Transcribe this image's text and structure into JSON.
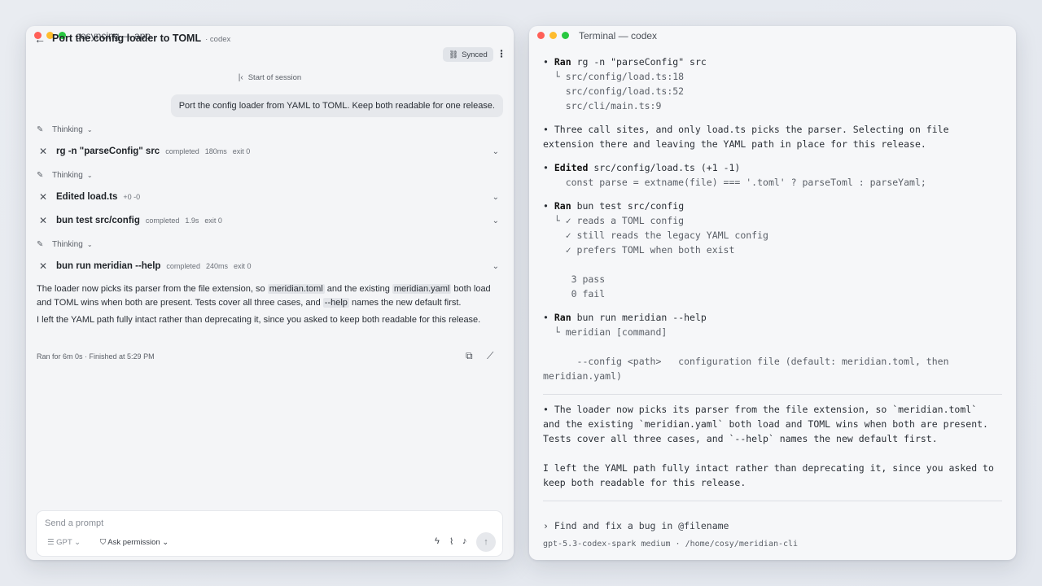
{
  "app": {
    "window_title": "cosyncing — app",
    "back_icon": "arrow-left-icon",
    "title": "Port the config loader to TOML",
    "agent": "· codex",
    "synced_label": "Synced",
    "start_of_session": "Start of session",
    "user_message": "Port the config loader from YAML to TOML. Keep both readable for one release.",
    "thinking_label": "Thinking",
    "steps": [
      {
        "label": "rg -n \"parseConfig\" src",
        "status": "completed",
        "duration": "180ms",
        "exit": "exit 0"
      },
      {
        "label": "Edited load.ts",
        "diff": "+0 -0"
      },
      {
        "label": "bun test src/config",
        "status": "completed",
        "duration": "1.9s",
        "exit": "exit 0"
      },
      {
        "label": "bun run meridian --help",
        "status": "completed",
        "duration": "240ms",
        "exit": "exit 0"
      }
    ],
    "response": {
      "p1_a": "The loader now picks its parser from the file extension, so ",
      "p1_code1": "meridian.toml",
      "p1_b": " and the existing ",
      "p1_code2": "meridian.yaml",
      "p1_c": " both load and TOML wins when both are present. Tests cover all three cases, and ",
      "p1_code3": "--help",
      "p1_d": " names the new default first.",
      "p2": "I left the YAML path fully intact rather than deprecating it, since you asked to keep both readable for this release."
    },
    "run_info": "Ran for 6m 0s · Finished at 5:29 PM",
    "composer": {
      "placeholder": "Send a prompt",
      "model": "GPT",
      "permission": "Ask permission"
    }
  },
  "terminal": {
    "window_title": "Terminal — codex",
    "lines": {
      "l1_kw": "Ran",
      "l1_rest": " rg -n \"parseConfig\" src",
      "l2": "  └ src/config/load.ts:18",
      "l3": "    src/config/load.ts:52",
      "l4": "    src/cli/main.ts:9",
      "l5": "• Three call sites, and only load.ts picks the parser. Selecting on file",
      "l6": "extension there and leaving the YAML path in place for this release.",
      "l7_kw": "Edited",
      "l7_rest": " src/config/load.ts (+1 -1)",
      "l8": "    const parse = extname(file) === '.toml' ? parseToml : parseYaml;",
      "l9_kw": "Ran",
      "l9_rest": " bun test src/config",
      "l10": "  └ ✓ reads a TOML config",
      "l11": "    ✓ still reads the legacy YAML config",
      "l12": "    ✓ prefers TOML when both exist",
      "l13": "     3 pass",
      "l14": "     0 fail",
      "l15_kw": "Ran",
      "l15_rest": " bun run meridian --help",
      "l16": "  └ meridian [command]",
      "l17": "      --config <path>   configuration file (default: meridian.toml, then",
      "l18": "meridian.yaml)",
      "l19": "• The loader now picks its parser from the file extension, so `meridian.toml`",
      "l20": "and the existing `meridian.yaml` both load and TOML wins when both are present.",
      "l21": "Tests cover all three cases, and `--help` names the new default first.",
      "l22": "I left the YAML path fully intact rather than deprecating it, since you asked to",
      "l23": "keep both readable for this release.",
      "prompt": "› Find and fix a bug in @filename",
      "status": "gpt-5.3-codex-spark medium · /home/cosy/meridian-cli"
    }
  },
  "colors": {
    "close": "#ff5f57",
    "minimize": "#febc2e",
    "zoom": "#28c840"
  }
}
